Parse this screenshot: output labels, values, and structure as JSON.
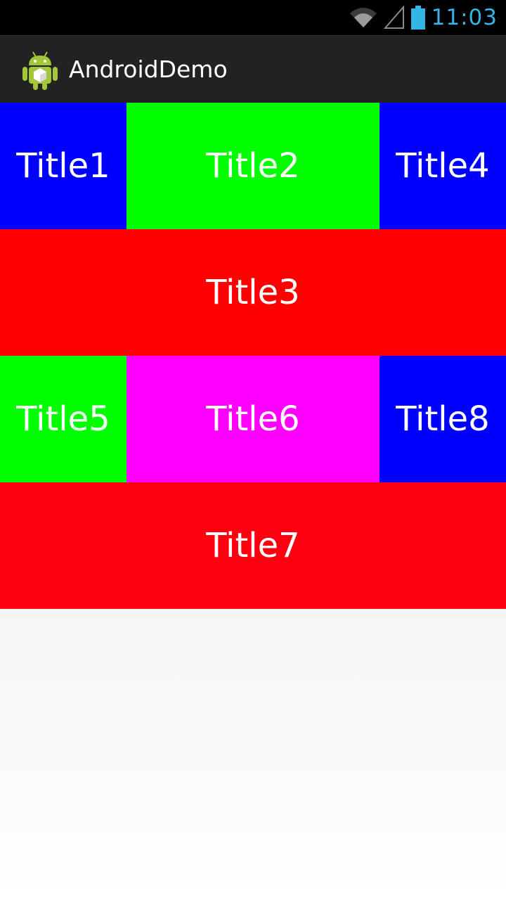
{
  "status_bar": {
    "time": "11:03",
    "icons": [
      "wifi-icon",
      "signal-icon",
      "battery-icon"
    ],
    "accent": "#33b5e5"
  },
  "action_bar": {
    "title": "AndroidDemo",
    "icon": "android-robot-icon"
  },
  "grid": {
    "tiles": [
      {
        "label": "Title1",
        "color": "#0000ff"
      },
      {
        "label": "Title2",
        "color": "#00ff00"
      },
      {
        "label": "Title4",
        "color": "#0000ff"
      },
      {
        "label": "Title3",
        "color": "#ff0000"
      },
      {
        "label": "Title5",
        "color": "#00ff00"
      },
      {
        "label": "Title6",
        "color": "#ff00ff"
      },
      {
        "label": "Title8",
        "color": "#0000ff"
      },
      {
        "label": "Title7",
        "color": "#ff0011"
      }
    ]
  }
}
